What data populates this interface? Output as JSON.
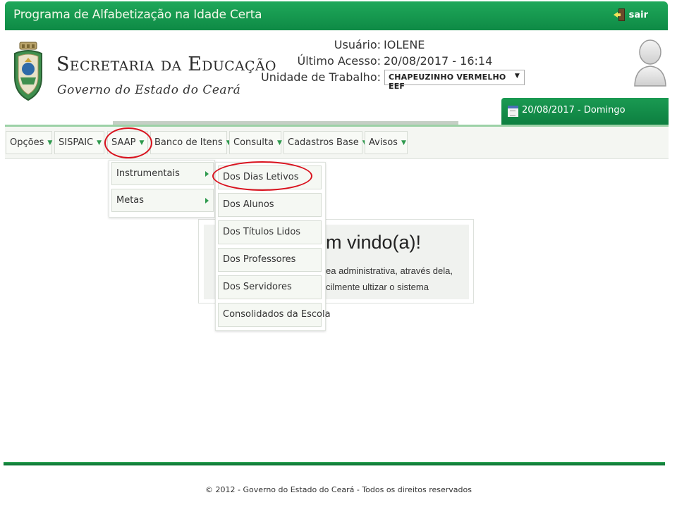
{
  "topbar": {
    "title": "Programa de Alfabetização na Idade Certa",
    "logout_label": "sair"
  },
  "header": {
    "org_title": "Secretaria da Educação",
    "org_subtitle": "Governo do Estado do Ceará"
  },
  "user": {
    "user_label": "Usuário:",
    "user_value": "IOLENE",
    "last_access_label": "Último Acesso:",
    "last_access_value": "20/08/2017 - 16:14",
    "unit_label": "Unidade de Trabalho:",
    "unit_value": "CHAPEUZINHO VERMELHO EEF"
  },
  "date_display": "20/08/2017 - Domingo",
  "menu": {
    "items": [
      {
        "label": "Opções"
      },
      {
        "label": "SISPAIC"
      },
      {
        "label": "SAAP"
      },
      {
        "label": "Banco de Itens"
      },
      {
        "label": "Consulta"
      },
      {
        "label": "Cadastros Base"
      },
      {
        "label": "Avisos"
      }
    ]
  },
  "saap_submenu": {
    "items": [
      {
        "label": "Instrumentais"
      },
      {
        "label": "Metas"
      }
    ]
  },
  "instrumentais_submenu": {
    "items": [
      {
        "label": "Dos Dias Letivos"
      },
      {
        "label": "Dos Alunos"
      },
      {
        "label": "Dos Títulos Lidos"
      },
      {
        "label": "Dos Professores"
      },
      {
        "label": "Dos Servidores"
      },
      {
        "label": "Consolidados da Escola"
      }
    ]
  },
  "welcome": {
    "title": "m vindo(a)!",
    "line1": "ea administrativa, através dela,",
    "line2": "cilmente ultizar o sistema"
  },
  "footer": {
    "text": "© 2012 - Governo do Estado do Ceará - Todos os direitos reservados"
  },
  "colors": {
    "brand_green": "#0e8a45",
    "annotation_red": "#d9121e",
    "caret_green": "#2f9a4e"
  }
}
